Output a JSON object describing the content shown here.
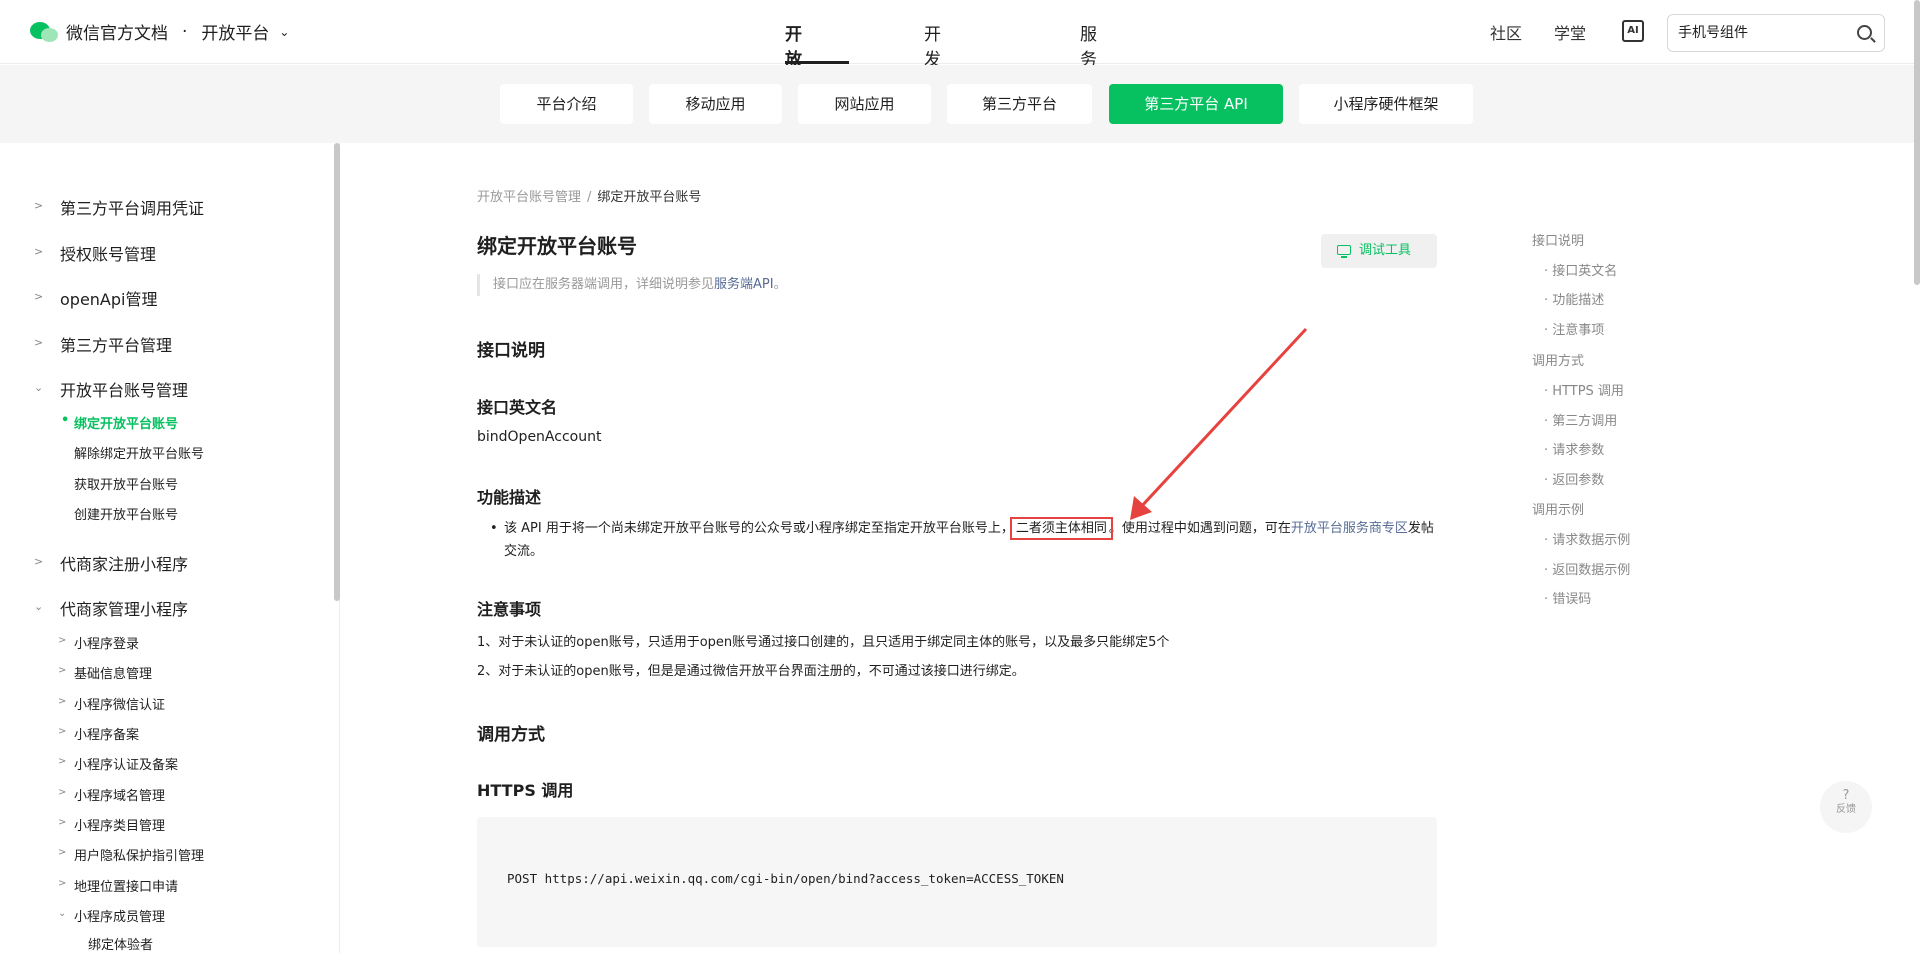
{
  "header": {
    "brand": "微信官方文档",
    "dot": "·",
    "section": "开放平台",
    "nav": [
      "开放平台",
      "开发者平台",
      "服务商"
    ],
    "right": [
      "社区",
      "学堂"
    ],
    "ai_label": "AI",
    "search_placeholder": "手机号组件"
  },
  "subtabs": [
    "平台介绍",
    "移动应用",
    "网站应用",
    "第三方平台",
    "第三方平台 API",
    "小程序硬件框架"
  ],
  "sidebar": {
    "top_items": [
      "第三方平台调用凭证",
      "授权账号管理",
      "openApi管理",
      "第三方平台管理",
      "开放平台账号管理"
    ],
    "open_platform_sub": [
      "绑定开放平台账号",
      "解除绑定开放平台账号",
      "获取开放平台账号",
      "创建开放平台账号"
    ],
    "items2": [
      "代商家注册小程序",
      "代商家管理小程序"
    ],
    "manage_sub": [
      "小程序登录",
      "基础信息管理",
      "小程序微信认证",
      "小程序备案",
      "小程序认证及备案",
      "小程序域名管理",
      "小程序类目管理",
      "用户隐私保护指引管理",
      "地理位置接口申请",
      "小程序成员管理"
    ],
    "member_sub": [
      "绑定体验者"
    ]
  },
  "main": {
    "breadcrumb_parent": "开放平台账号管理",
    "breadcrumb_sep": "/",
    "breadcrumb_current": "绑定开放平台账号",
    "title": "绑定开放平台账号",
    "debug_button": "调试工具",
    "note_prefix": "接口应在服务器端调用，详细说明参见",
    "note_link": "服务端API",
    "note_suffix": "。",
    "h_interface": "接口说明",
    "h_en_name": "接口英文名",
    "en_name": "bindOpenAccount",
    "h_func": "功能描述",
    "func_bullet": "•",
    "func_text_1": "该 API 用于将一个尚未绑定开放平台账号的公众号或小程序绑定至指定开放平台账号上，",
    "func_highlight": "二者须主体相同",
    "func_text_2": "。使用过程中如遇到问题，可在",
    "func_link": "开放平台服务商专区",
    "func_text_3": "发帖交流。",
    "h_notes": "注意事项",
    "note_1": "1、对于未认证的open账号，只适用于open账号通过接口创建的，且只适用于绑定同主体的账号，以及最多只能绑定5个",
    "note_2": "2、对于未认证的open账号，但是是通过微信开放平台界面注册的，不可通过该接口进行绑定。",
    "h_call": "调用方式",
    "h_https": "HTTPS 调用",
    "code": "POST https://api.weixin.qq.com/cgi-bin/open/bind?access_token=ACCESS_TOKEN"
  },
  "toc": [
    {
      "label": "接口说明",
      "level": 1
    },
    {
      "label": "· 接口英文名",
      "level": 2
    },
    {
      "label": "· 功能描述",
      "level": 2
    },
    {
      "label": "· 注意事项",
      "level": 2
    },
    {
      "label": "调用方式",
      "level": 1
    },
    {
      "label": "· HTTPS 调用",
      "level": 2
    },
    {
      "label": "· 第三方调用",
      "level": 2
    },
    {
      "label": "· 请求参数",
      "level": 2
    },
    {
      "label": "· 返回参数",
      "level": 2
    },
    {
      "label": "调用示例",
      "level": 1
    },
    {
      "label": "· 请求数据示例",
      "level": 2
    },
    {
      "label": "· 返回数据示例",
      "level": 2
    },
    {
      "label": "· 错误码",
      "level": 2
    }
  ],
  "feedback": {
    "icon": "?",
    "label": "反馈"
  },
  "colors": {
    "accent": "#07c160",
    "link": "#576b95",
    "annotation": "#e64340"
  }
}
